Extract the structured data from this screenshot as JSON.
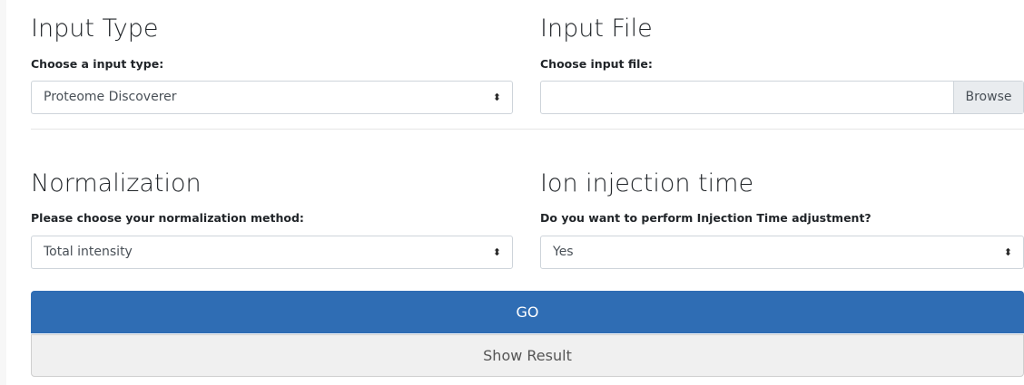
{
  "input_type": {
    "title": "Input Type",
    "label": "Choose a input type:",
    "selected": "Proteome Discoverer",
    "caret_icon": "up-down-caret-icon"
  },
  "input_file": {
    "title": "Input File",
    "label": "Choose input file:",
    "value": "",
    "browse_label": "Browse"
  },
  "normalization": {
    "title": "Normalization",
    "label": "Please choose your normalization method:",
    "selected": "Total intensity"
  },
  "injection_time": {
    "title": "Ion injection time",
    "label": "Do you want to perform Injection Time adjustment?",
    "selected": "Yes"
  },
  "actions": {
    "go_label": "GO",
    "show_result_label": "Show Result",
    "go_color": "#2f6db4"
  },
  "icons": {
    "caret": "⬍"
  }
}
